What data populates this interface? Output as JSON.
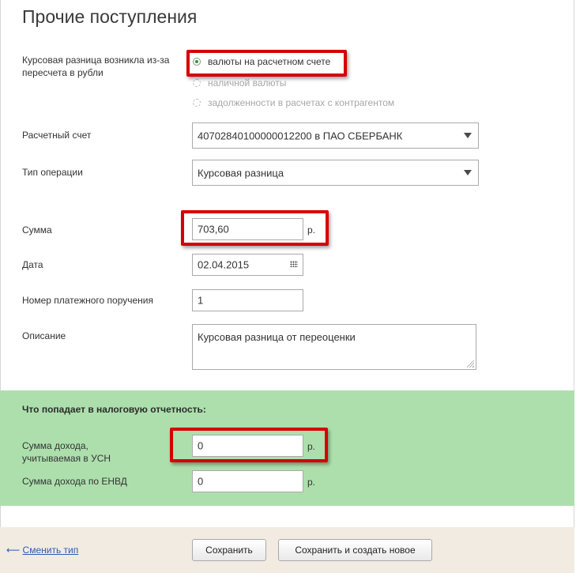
{
  "page": {
    "title": "Прочие поступления"
  },
  "form": {
    "reason_label_line1": "Курсовая разница возникла из-за",
    "reason_label_line2": "пересчета в рубли",
    "reason_options": [
      {
        "label": "валюты на расчетном счете",
        "selected": true,
        "enabled": true
      },
      {
        "label": "наличной валюты",
        "selected": false,
        "enabled": false
      },
      {
        "label": "задолженности в расчетах с контрагентом",
        "selected": false,
        "enabled": false
      }
    ],
    "account_label": "Расчетный счет",
    "account_value": "40702840100000012200 в ПАО СБЕРБАНК",
    "operation_label": "Тип операции",
    "operation_value": "Курсовая разница",
    "sum_label": "Сумма",
    "sum_value": "703,60",
    "currency_unit": "р.",
    "date_label": "Дата",
    "date_value": "02.04.2015",
    "order_label": "Номер платежного поручения",
    "order_value": "1",
    "description_label": "Описание",
    "description_value": "Курсовая разница от переоценки"
  },
  "tax": {
    "section_title": "Что попадает в налоговую отчетность:",
    "usn_label_line1": "Сумма дохода,",
    "usn_label_line2": "учитываемая в УСН",
    "usn_value": "0",
    "envd_label": "Сумма дохода по ЕНВД",
    "envd_value": "0",
    "unit": "р."
  },
  "footer": {
    "back_arrow": "⟵",
    "change_type_link": "Сменить тип",
    "save_button": "Сохранить",
    "save_and_new_button": "Сохранить и создать новое"
  },
  "colors": {
    "highlight": "#d60000",
    "tax_section_bg": "#addfad",
    "footer_bg": "#f2ebe2",
    "link": "#2a5db0"
  }
}
